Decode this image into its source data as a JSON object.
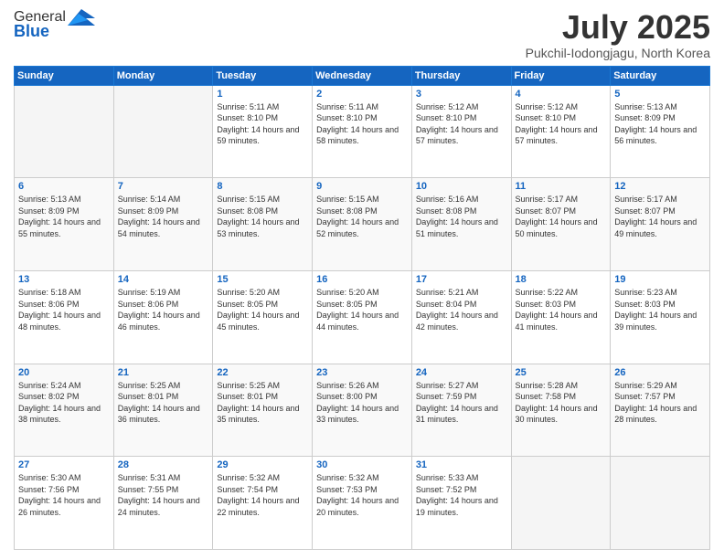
{
  "header": {
    "logo_general": "General",
    "logo_blue": "Blue",
    "title": "July 2025",
    "location": "Pukchil-Iodongjagu, North Korea"
  },
  "weekdays": [
    "Sunday",
    "Monday",
    "Tuesday",
    "Wednesday",
    "Thursday",
    "Friday",
    "Saturday"
  ],
  "weeks": [
    [
      {
        "day": "",
        "info": ""
      },
      {
        "day": "",
        "info": ""
      },
      {
        "day": "1",
        "info": "Sunrise: 5:11 AM\nSunset: 8:10 PM\nDaylight: 14 hours and 59 minutes."
      },
      {
        "day": "2",
        "info": "Sunrise: 5:11 AM\nSunset: 8:10 PM\nDaylight: 14 hours and 58 minutes."
      },
      {
        "day": "3",
        "info": "Sunrise: 5:12 AM\nSunset: 8:10 PM\nDaylight: 14 hours and 57 minutes."
      },
      {
        "day": "4",
        "info": "Sunrise: 5:12 AM\nSunset: 8:10 PM\nDaylight: 14 hours and 57 minutes."
      },
      {
        "day": "5",
        "info": "Sunrise: 5:13 AM\nSunset: 8:09 PM\nDaylight: 14 hours and 56 minutes."
      }
    ],
    [
      {
        "day": "6",
        "info": "Sunrise: 5:13 AM\nSunset: 8:09 PM\nDaylight: 14 hours and 55 minutes."
      },
      {
        "day": "7",
        "info": "Sunrise: 5:14 AM\nSunset: 8:09 PM\nDaylight: 14 hours and 54 minutes."
      },
      {
        "day": "8",
        "info": "Sunrise: 5:15 AM\nSunset: 8:08 PM\nDaylight: 14 hours and 53 minutes."
      },
      {
        "day": "9",
        "info": "Sunrise: 5:15 AM\nSunset: 8:08 PM\nDaylight: 14 hours and 52 minutes."
      },
      {
        "day": "10",
        "info": "Sunrise: 5:16 AM\nSunset: 8:08 PM\nDaylight: 14 hours and 51 minutes."
      },
      {
        "day": "11",
        "info": "Sunrise: 5:17 AM\nSunset: 8:07 PM\nDaylight: 14 hours and 50 minutes."
      },
      {
        "day": "12",
        "info": "Sunrise: 5:17 AM\nSunset: 8:07 PM\nDaylight: 14 hours and 49 minutes."
      }
    ],
    [
      {
        "day": "13",
        "info": "Sunrise: 5:18 AM\nSunset: 8:06 PM\nDaylight: 14 hours and 48 minutes."
      },
      {
        "day": "14",
        "info": "Sunrise: 5:19 AM\nSunset: 8:06 PM\nDaylight: 14 hours and 46 minutes."
      },
      {
        "day": "15",
        "info": "Sunrise: 5:20 AM\nSunset: 8:05 PM\nDaylight: 14 hours and 45 minutes."
      },
      {
        "day": "16",
        "info": "Sunrise: 5:20 AM\nSunset: 8:05 PM\nDaylight: 14 hours and 44 minutes."
      },
      {
        "day": "17",
        "info": "Sunrise: 5:21 AM\nSunset: 8:04 PM\nDaylight: 14 hours and 42 minutes."
      },
      {
        "day": "18",
        "info": "Sunrise: 5:22 AM\nSunset: 8:03 PM\nDaylight: 14 hours and 41 minutes."
      },
      {
        "day": "19",
        "info": "Sunrise: 5:23 AM\nSunset: 8:03 PM\nDaylight: 14 hours and 39 minutes."
      }
    ],
    [
      {
        "day": "20",
        "info": "Sunrise: 5:24 AM\nSunset: 8:02 PM\nDaylight: 14 hours and 38 minutes."
      },
      {
        "day": "21",
        "info": "Sunrise: 5:25 AM\nSunset: 8:01 PM\nDaylight: 14 hours and 36 minutes."
      },
      {
        "day": "22",
        "info": "Sunrise: 5:25 AM\nSunset: 8:01 PM\nDaylight: 14 hours and 35 minutes."
      },
      {
        "day": "23",
        "info": "Sunrise: 5:26 AM\nSunset: 8:00 PM\nDaylight: 14 hours and 33 minutes."
      },
      {
        "day": "24",
        "info": "Sunrise: 5:27 AM\nSunset: 7:59 PM\nDaylight: 14 hours and 31 minutes."
      },
      {
        "day": "25",
        "info": "Sunrise: 5:28 AM\nSunset: 7:58 PM\nDaylight: 14 hours and 30 minutes."
      },
      {
        "day": "26",
        "info": "Sunrise: 5:29 AM\nSunset: 7:57 PM\nDaylight: 14 hours and 28 minutes."
      }
    ],
    [
      {
        "day": "27",
        "info": "Sunrise: 5:30 AM\nSunset: 7:56 PM\nDaylight: 14 hours and 26 minutes."
      },
      {
        "day": "28",
        "info": "Sunrise: 5:31 AM\nSunset: 7:55 PM\nDaylight: 14 hours and 24 minutes."
      },
      {
        "day": "29",
        "info": "Sunrise: 5:32 AM\nSunset: 7:54 PM\nDaylight: 14 hours and 22 minutes."
      },
      {
        "day": "30",
        "info": "Sunrise: 5:32 AM\nSunset: 7:53 PM\nDaylight: 14 hours and 20 minutes."
      },
      {
        "day": "31",
        "info": "Sunrise: 5:33 AM\nSunset: 7:52 PM\nDaylight: 14 hours and 19 minutes."
      },
      {
        "day": "",
        "info": ""
      },
      {
        "day": "",
        "info": ""
      }
    ]
  ]
}
